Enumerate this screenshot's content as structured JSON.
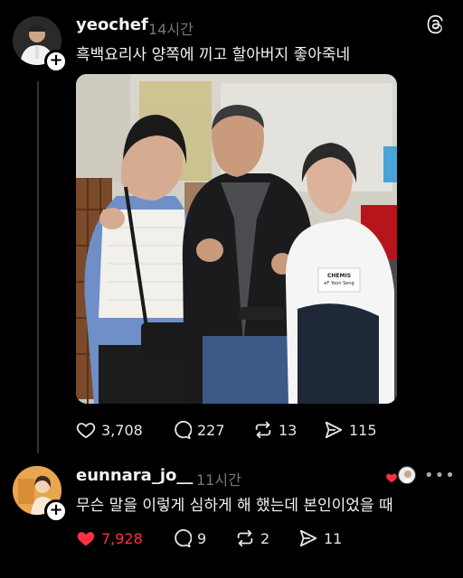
{
  "post": {
    "username": "yeochef",
    "time": "14시간",
    "text": "흑백요리사 양쪽에 끼고 할아버지 좋아죽네",
    "likes": "3,708",
    "comments": "227",
    "reposts": "13",
    "shares": "115"
  },
  "reply": {
    "username": "eunnara_jo__",
    "time": "11시간",
    "text": "무슨 말을 이렇게 심하게 해 했는데 본인이었을 때",
    "likes": "7,928",
    "comments": "9",
    "reposts": "2",
    "shares": "11"
  },
  "photo_text": {
    "coat_label": "CHEMIS",
    "coat_name": "eF Yoon Seng"
  },
  "colors": {
    "background": "#000000",
    "liked_red": "#ff3040",
    "muted": "#777777"
  },
  "icons": [
    "threads-logo-icon",
    "heart-icon",
    "comment-icon",
    "repost-icon",
    "share-icon",
    "plus-icon",
    "more-icon"
  ]
}
